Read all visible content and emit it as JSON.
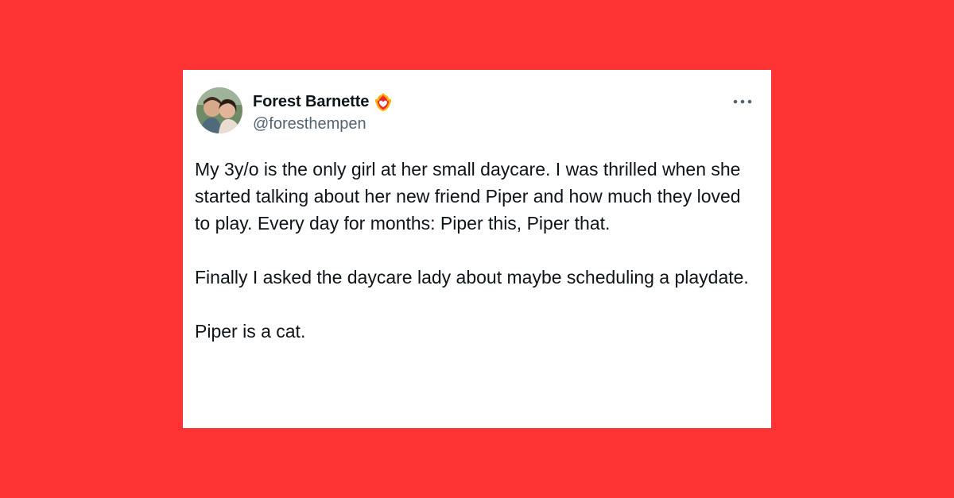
{
  "colors": {
    "background": "#fe3334",
    "card": "#ffffff",
    "name_text": "#0f1419",
    "handle_text": "#536471",
    "badge": "#f4212e"
  },
  "tweet": {
    "author": {
      "display_name": "Forest Barnette",
      "handle": "@foresthempen",
      "badge_icon": "flaming-heart-icon",
      "avatar_icon": "profile-photo-avatar"
    },
    "more_icon": "ellipsis-icon",
    "paragraphs": [
      "My 3y/o is the only girl at her small daycare. I was thrilled when she started talking about her new friend Piper and how much they loved to play. Every day for months: Piper this, Piper that.",
      "Finally I asked the daycare lady about maybe scheduling a playdate.",
      "Piper is a cat."
    ]
  }
}
